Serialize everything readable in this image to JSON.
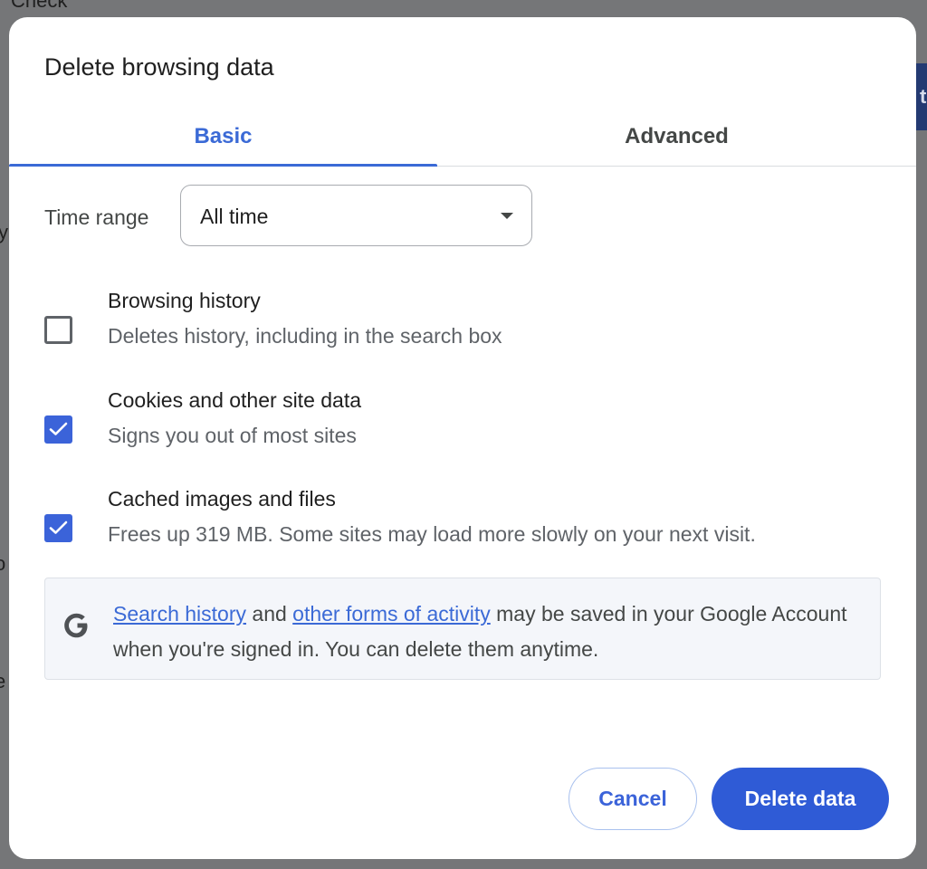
{
  "background": {
    "fragment_top": "Check",
    "fragment_left_1": "y",
    "fragment_left_2": "o",
    "fragment_left_3": "e",
    "fragment_right": "t"
  },
  "dialog": {
    "title": "Delete browsing data",
    "tabs": [
      {
        "label": "Basic",
        "active": true
      },
      {
        "label": "Advanced",
        "active": false
      }
    ],
    "time_range": {
      "label": "Time range",
      "value": "All time"
    },
    "options": [
      {
        "title": "Browsing history",
        "description": "Deletes history, including in the search box",
        "checked": false
      },
      {
        "title": "Cookies and other site data",
        "description": "Signs you out of most sites",
        "checked": true
      },
      {
        "title": "Cached images and files",
        "description": "Frees up 319 MB. Some sites may load more slowly on your next visit.",
        "checked": true
      }
    ],
    "info": {
      "link1": "Search history",
      "text1": " and ",
      "link2": "other forms of activity",
      "text2": " may be saved in your Google Account when you're signed in. You can delete them anytime."
    },
    "buttons": {
      "cancel": "Cancel",
      "delete": "Delete data"
    }
  },
  "colors": {
    "accent": "#3b6ad6",
    "primary_button": "#2f5bd6",
    "checkbox_checked": "#3b63d9",
    "info_background": "#f4f6fa"
  }
}
